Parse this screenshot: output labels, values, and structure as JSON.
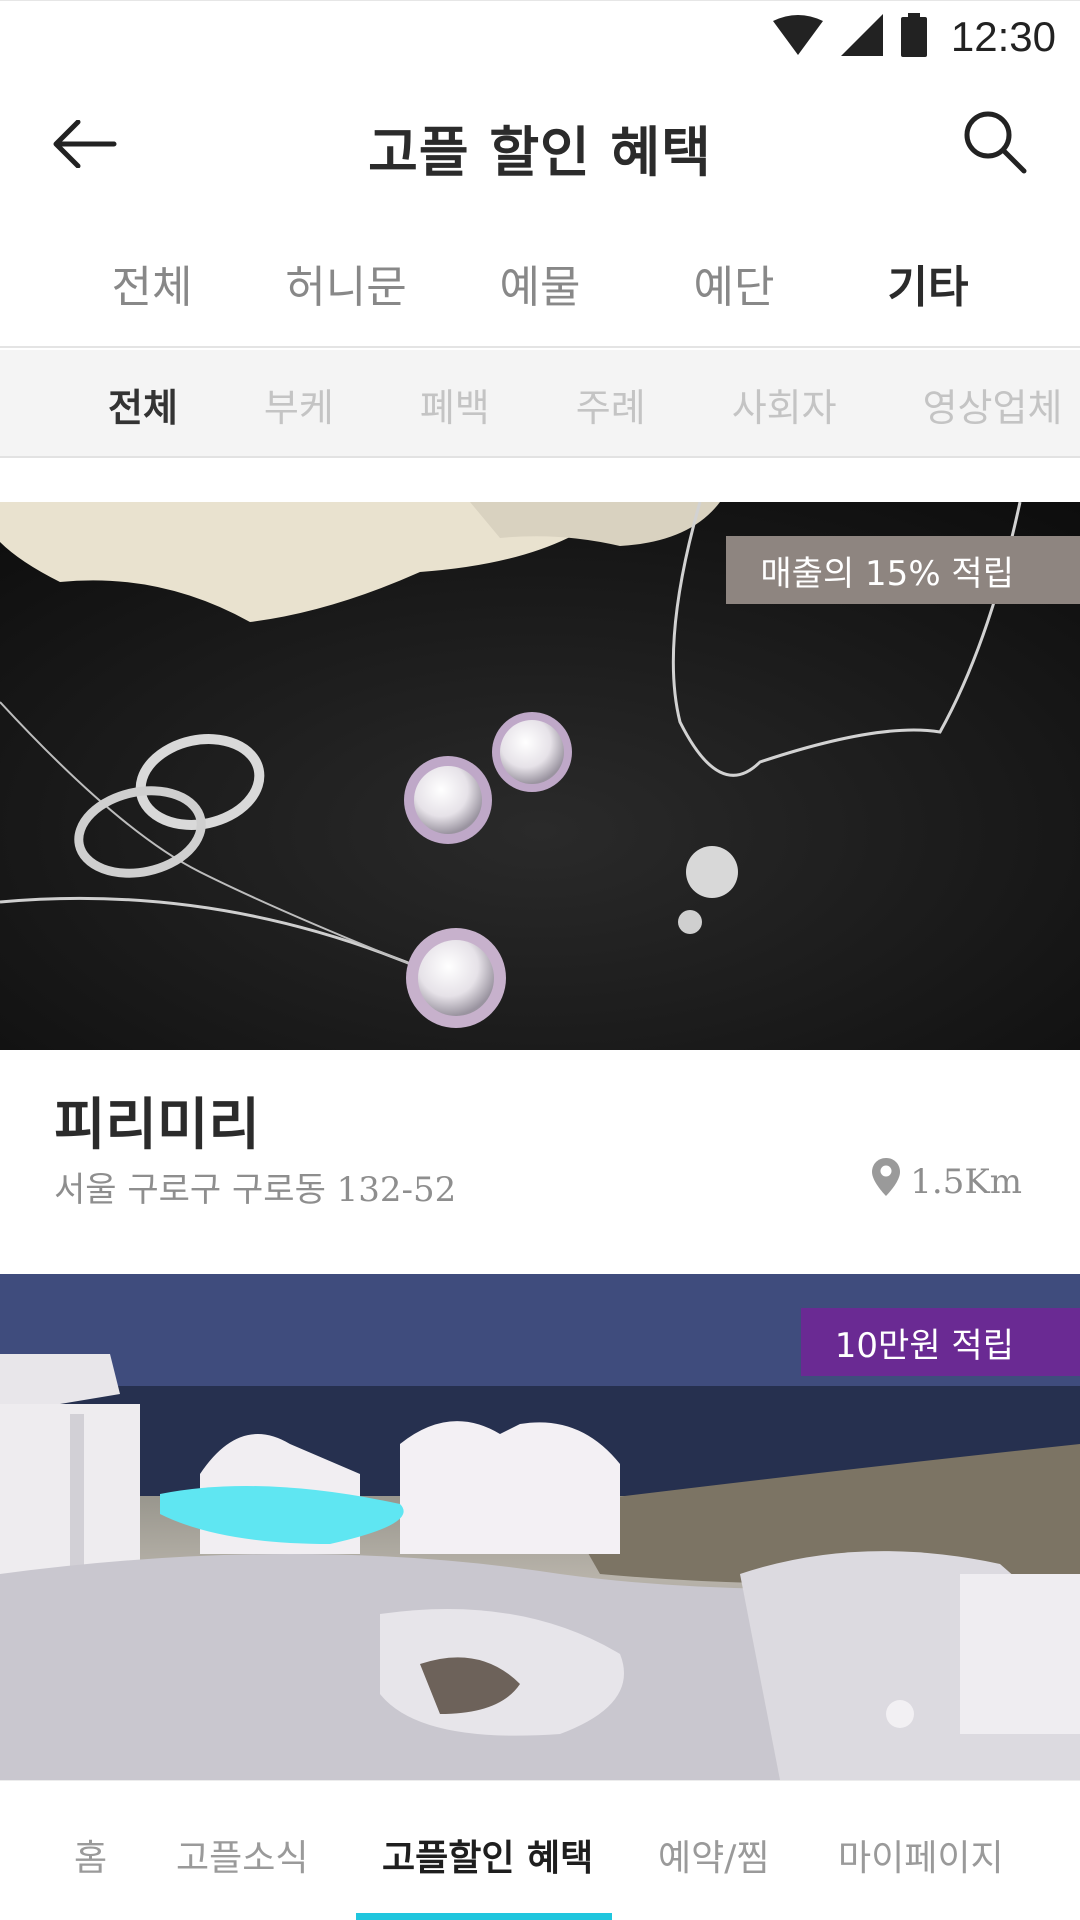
{
  "status_bar": {
    "time": "12:30",
    "icons": [
      "wifi-icon",
      "cell-signal-icon",
      "battery-icon"
    ]
  },
  "header": {
    "title": "고플 할인 혜택",
    "back_icon": "arrow-left-icon",
    "search_icon": "search-icon"
  },
  "main_tabs": [
    {
      "label": "전체",
      "active": false
    },
    {
      "label": "허니문",
      "active": false
    },
    {
      "label": "예물",
      "active": false
    },
    {
      "label": "예단",
      "active": false
    },
    {
      "label": "기타",
      "active": true
    }
  ],
  "sub_tabs": [
    {
      "label": "전체",
      "active": true
    },
    {
      "label": "부케",
      "active": false
    },
    {
      "label": "폐백",
      "active": false
    },
    {
      "label": "주례",
      "active": false
    },
    {
      "label": "사회자",
      "active": false
    },
    {
      "label": "영상업체",
      "active": false
    }
  ],
  "listings": [
    {
      "badge": "매출의 15% 적립",
      "badge_color": "#8e8580",
      "name": "피리미리",
      "address": "서울 구로구 구로동 132-52",
      "distance": "1.5Km",
      "image": "jewelry-photo"
    },
    {
      "badge": "10만원 적립",
      "badge_color": "#6a2a93",
      "image": "resort-photo"
    }
  ],
  "bottom_nav": [
    {
      "label": "홈",
      "active": false
    },
    {
      "label": "고플소식",
      "active": false
    },
    {
      "label": "고플할인 혜택",
      "active": true
    },
    {
      "label": "예약/찜",
      "active": false
    },
    {
      "label": "마이페이지",
      "active": false
    }
  ],
  "colors": {
    "accent_indicator": "#1fc6de",
    "badge_gray": "#8e8580",
    "badge_purple": "#6a2a93",
    "text_dark": "#2b2b2b",
    "text_muted": "#8e8e8e"
  }
}
